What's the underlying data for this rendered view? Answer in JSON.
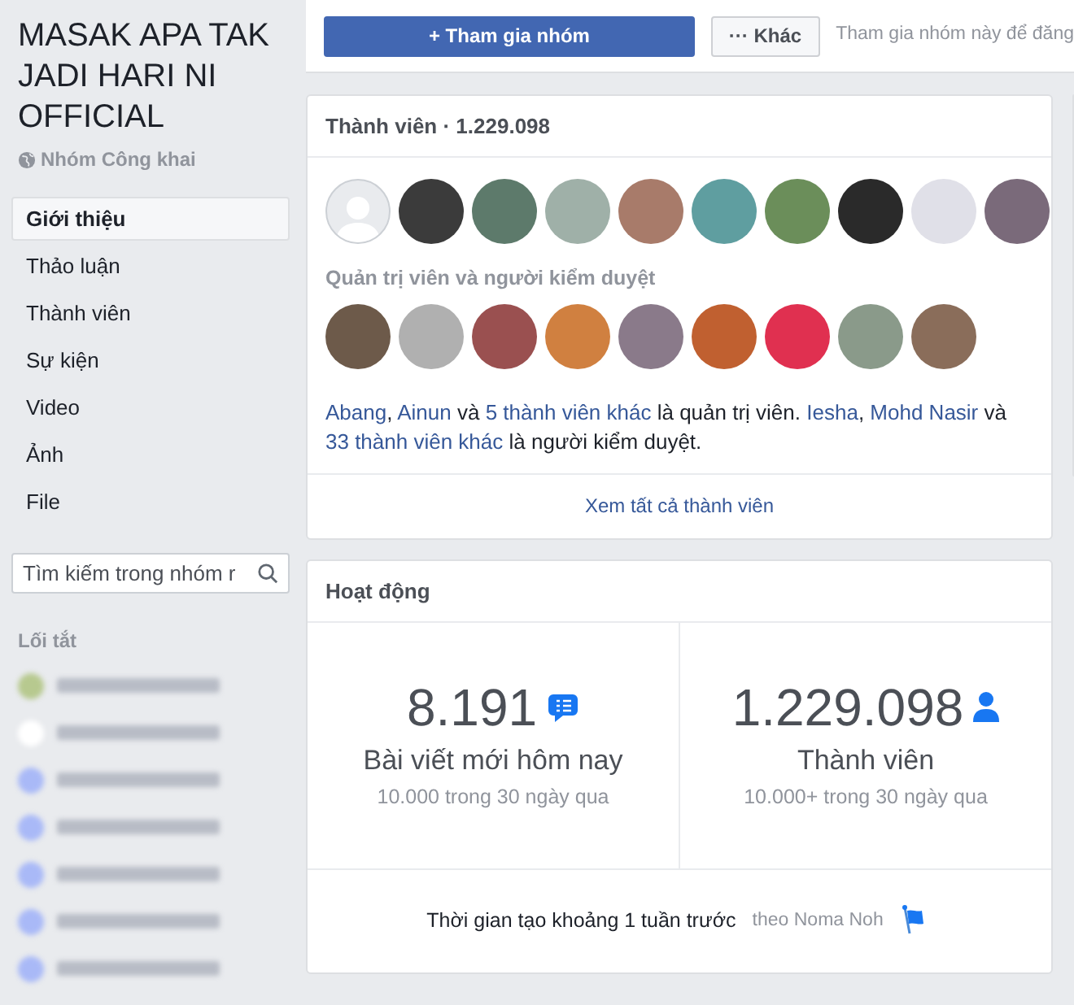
{
  "group": {
    "title": "MASAK APA TAK JADI HARI NI OFFICIAL",
    "privacy": "Nhóm Công khai"
  },
  "nav": [
    {
      "label": "Giới thiệu",
      "selected": true
    },
    {
      "label": "Thảo luận",
      "selected": false
    },
    {
      "label": "Thành viên",
      "selected": false
    },
    {
      "label": "Sự kiện",
      "selected": false
    },
    {
      "label": "Video",
      "selected": false
    },
    {
      "label": "Ảnh",
      "selected": false
    },
    {
      "label": "File",
      "selected": false
    }
  ],
  "search": {
    "placeholder": "Tìm kiếm trong nhóm r"
  },
  "shortcuts": {
    "heading": "Lối tắt",
    "items": [
      {
        "color": "#b7c98f"
      },
      {
        "color": "#ffffff"
      },
      {
        "color": "#a9b9f7"
      },
      {
        "color": "#a9b9f7"
      },
      {
        "color": "#a9b9f7"
      },
      {
        "color": "#a9b9f7"
      },
      {
        "color": "#a9b9f7"
      }
    ]
  },
  "actions": {
    "join": "+ Tham gia nhóm",
    "more": "··· Khác",
    "hint": "Tham gia nhóm này để đăng"
  },
  "members": {
    "title": "Thành viên · 1.229.098",
    "avatars": [
      {
        "kind": "default"
      },
      {
        "kind": "photo"
      },
      {
        "kind": "photo"
      },
      {
        "kind": "photo"
      },
      {
        "kind": "photo"
      },
      {
        "kind": "photo"
      },
      {
        "kind": "photo"
      },
      {
        "kind": "photo"
      },
      {
        "kind": "photo"
      },
      {
        "kind": "photo"
      }
    ],
    "admins_heading": "Quản trị viên và người kiểm duyệt",
    "admin_avatars": [
      {
        "kind": "photo"
      },
      {
        "kind": "photo"
      },
      {
        "kind": "photo"
      },
      {
        "kind": "photo"
      },
      {
        "kind": "photo"
      },
      {
        "kind": "photo"
      },
      {
        "kind": "photo"
      },
      {
        "kind": "photo"
      },
      {
        "kind": "photo"
      }
    ],
    "summary": [
      {
        "text": "Abang",
        "link": true
      },
      {
        "text": ", ",
        "link": false
      },
      {
        "text": "Ainun",
        "link": true
      },
      {
        "text": " và ",
        "link": false
      },
      {
        "text": "5 thành viên khác",
        "link": true
      },
      {
        "text": " là quản trị viên. ",
        "link": false
      },
      {
        "text": "Iesha",
        "link": true
      },
      {
        "text": ", ",
        "link": false
      },
      {
        "text": "Mohd Nasir",
        "link": true
      },
      {
        "text": " và ",
        "link": false
      },
      {
        "text": "33 thành viên khác",
        "link": true
      },
      {
        "text": " là người kiểm duyệt.",
        "link": false
      }
    ],
    "see_all": "Xem tất cả thành viên"
  },
  "activity": {
    "title": "Hoạt động",
    "stats": [
      {
        "kind": "posts",
        "value": "8.191",
        "label": "Bài viết mới hôm nay",
        "sub": "10.000 trong 30 ngày qua"
      },
      {
        "kind": "members",
        "value": "1.229.098",
        "label": "Thành viên",
        "sub": "10.000+ trong 30 ngày qua"
      }
    ],
    "created": "Thời gian tạo khoảng 1 tuần trước",
    "created_by": "theo Noma Noh"
  }
}
